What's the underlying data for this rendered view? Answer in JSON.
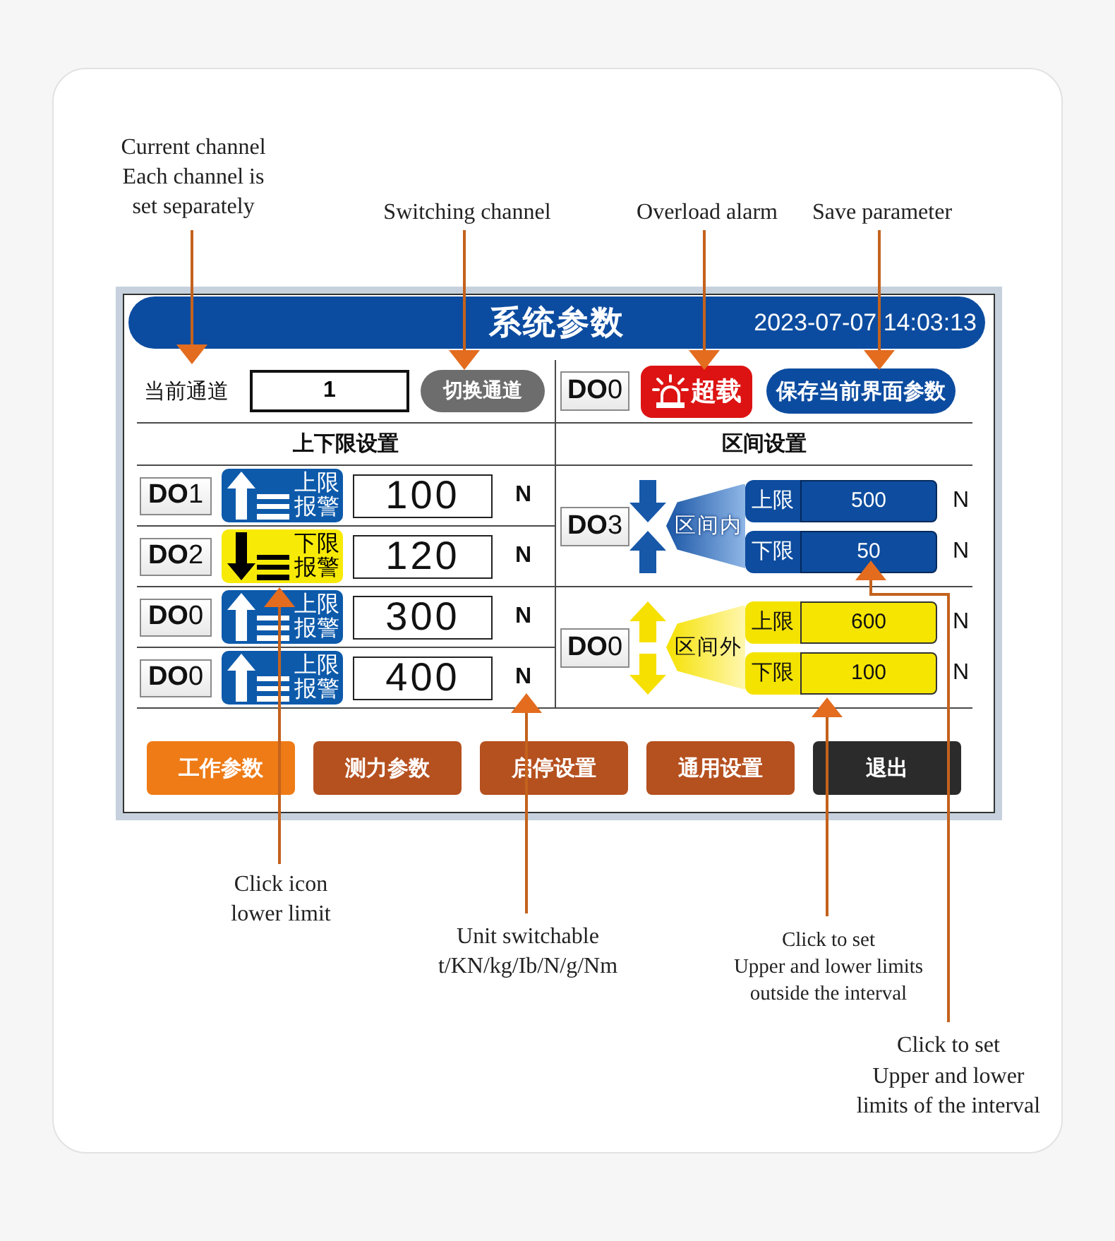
{
  "top_callouts": [
    "Current channel\nEach channel is\nset separately",
    "Switching channel",
    "Overload alarm",
    "Save parameter"
  ],
  "screen": {
    "title": "系统参数",
    "datetime": "2023-07-07 14:03:13",
    "channel": {
      "label": "当前通道",
      "value": "1"
    },
    "switch_button": "切换通道",
    "output": "**DO**0",
    "alarm": {
      "label": "超载",
      "active": true
    },
    "save_button": "保存当前界面参数",
    "limits": {
      "title": "上下限设置",
      "rows": [
        {
          "output": "**DO**1",
          "kind": "upper",
          "alarm": "上限报警",
          "value": "100",
          "unit": "N"
        },
        {
          "output": "**DO**2",
          "kind": "lower",
          "alarm": "下限报警",
          "value": "120",
          "unit": "N"
        },
        {
          "output": "**DO**0",
          "kind": "upper",
          "alarm": "上限报警",
          "value": "300",
          "unit": "N"
        },
        {
          "output": "**DO**0",
          "kind": "upper",
          "alarm": "上限报警",
          "value": "400",
          "unit": "N"
        }
      ]
    },
    "intervals": {
      "title": "区间设置",
      "groups": [
        {
          "output": "**DO**3",
          "kind": "inside",
          "label": "区间内",
          "fields": [
            {
              "label": "上限",
              "value": "500",
              "unit": "N"
            },
            {
              "label": "下限",
              "value": "50",
              "unit": "N"
            }
          ]
        },
        {
          "output": "**DO**0",
          "kind": "outside",
          "label": "区间外",
          "fields": [
            {
              "label": "上限",
              "value": "600",
              "unit": "N"
            },
            {
              "label": "下限",
              "value": "100",
              "unit": "N"
            }
          ]
        }
      ]
    },
    "nav_buttons": [
      {
        "label": "工作参数",
        "kind": "page",
        "selected": true
      },
      {
        "label": "测力参数",
        "kind": "page",
        "selected": false
      },
      {
        "label": "启停设置",
        "kind": "page",
        "selected": false
      },
      {
        "label": "通用设置",
        "kind": "page",
        "selected": false
      },
      {
        "label": "退出",
        "kind": "exit",
        "selected": false
      }
    ]
  },
  "bottom_callouts": [
    "Click icon\nlower limit",
    "Unit switchable\nt/KN/kg/Ib/N/g/Nm",
    "Click to set\nUpper and lower limits\noutside the interval",
    "Click to set\nUpper and lower\nlimits of the interval"
  ]
}
